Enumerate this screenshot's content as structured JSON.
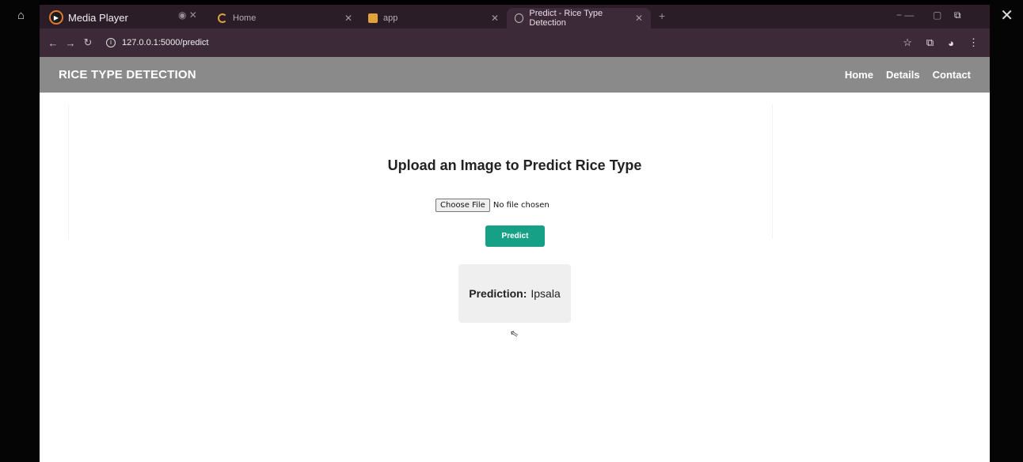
{
  "media_player": {
    "title": "Media Player"
  },
  "browser": {
    "tabs": [
      {
        "label": "Home"
      },
      {
        "label": "app"
      },
      {
        "label": "Predict - Rice Type Detection"
      }
    ],
    "url": "127.0.0.1:5000/predict"
  },
  "site": {
    "brand": "RICE TYPE DETECTION",
    "nav": [
      "Home",
      "Details",
      "Contact"
    ]
  },
  "upload": {
    "heading": "Upload an Image to Predict Rice Type",
    "choose_file_label": "Choose File",
    "file_status": "No file chosen",
    "predict_label": "Predict"
  },
  "result": {
    "label": "Prediction:",
    "value": "Ipsala"
  },
  "colors": {
    "navbar": "#8a8a8a",
    "predict_button": "#16a085",
    "browser_chrome": "#3d2a38"
  }
}
